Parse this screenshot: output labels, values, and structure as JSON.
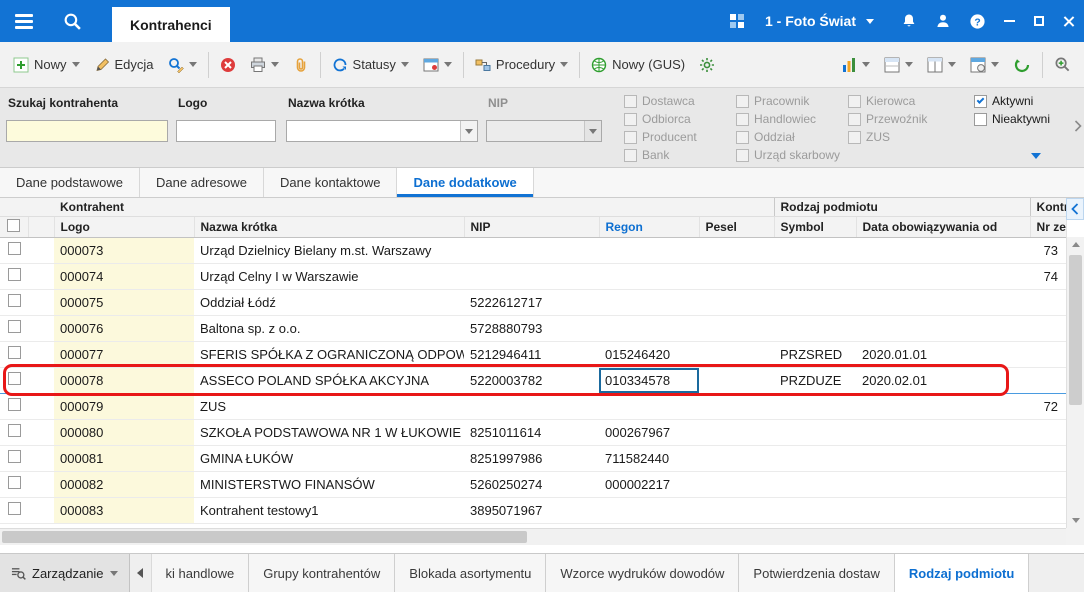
{
  "topbar": {
    "tab": "Kontrahenci",
    "company": "1 - Foto Świat"
  },
  "toolbar": {
    "nowy": "Nowy",
    "edycja": "Edycja",
    "statusy": "Statusy",
    "procedury": "Procedury",
    "nowy_gus": "Nowy (GUS)"
  },
  "filters": {
    "szukaj_label": "Szukaj kontrahenta",
    "szukaj_value": "",
    "logo_label": "Logo",
    "logo_value": "",
    "nazwa_label": "Nazwa krótka",
    "nazwa_value": "",
    "nip_label": "NIP",
    "nip_value": "",
    "roles_col1": [
      {
        "label": "Dostawca"
      },
      {
        "label": "Odbiorca"
      },
      {
        "label": "Producent"
      },
      {
        "label": "Bank"
      }
    ],
    "roles_col2": [
      {
        "label": "Pracownik"
      },
      {
        "label": "Handlowiec"
      },
      {
        "label": "Oddział"
      },
      {
        "label": "Urząd skarbowy"
      }
    ],
    "roles_col3": [
      {
        "label": "Kierowca"
      },
      {
        "label": "Przewoźnik"
      },
      {
        "label": "ZUS"
      }
    ],
    "aktywni": "Aktywni",
    "aktywni_checked": true,
    "nieaktywni": "Nieaktywni",
    "nieaktywni_checked": false
  },
  "tabs": {
    "items": [
      {
        "label": "Dane podstawowe",
        "active": false
      },
      {
        "label": "Dane adresowe",
        "active": false
      },
      {
        "label": "Dane kontaktowe",
        "active": false
      },
      {
        "label": "Dane dodatkowe",
        "active": true
      }
    ]
  },
  "table": {
    "group_kontrahent": "Kontrahent",
    "group_rodzaj_podmiotu": "Rodzaj podmiotu",
    "group_kontrah_cut": "Kontrah",
    "col_logo": "Logo",
    "col_nazwa": "Nazwa krótka",
    "col_nip": "NIP",
    "col_regon": "Regon",
    "col_pesel": "Pesel",
    "col_symbol": "Symbol",
    "col_data_od": "Data obowiązywania od",
    "col_nr_cut": "Nr zew",
    "rows": [
      {
        "logo": "000073",
        "nazwa": "Urząd Dzielnicy Bielany m.st. Warszawy",
        "nip": "",
        "regon": "",
        "pesel": "",
        "symbol": "",
        "data_od": "",
        "nr": "73"
      },
      {
        "logo": "000074",
        "nazwa": "Urząd Celny I w Warszawie",
        "nip": "",
        "regon": "",
        "pesel": "",
        "symbol": "",
        "data_od": "",
        "nr": "74"
      },
      {
        "logo": "000075",
        "nazwa": "Oddział Łódź",
        "nip": "5222612717",
        "regon": "",
        "pesel": "",
        "symbol": "",
        "data_od": "",
        "nr": ""
      },
      {
        "logo": "000076",
        "nazwa": "Baltona sp. z o.o.",
        "nip": "5728880793",
        "regon": "",
        "pesel": "",
        "symbol": "",
        "data_od": "",
        "nr": ""
      },
      {
        "logo": "000077",
        "nazwa": "SFERIS SPÓŁKA Z OGRANICZONĄ ODPOW",
        "nip": "5212946411",
        "regon": "015246420",
        "pesel": "",
        "symbol": "PRZSRED",
        "data_od": "2020.01.01",
        "nr": ""
      },
      {
        "logo": "000078",
        "nazwa": "ASSECO POLAND SPÓŁKA AKCYJNA",
        "nip": "5220003782",
        "regon": "010334578",
        "pesel": "",
        "symbol": "PRZDUZE",
        "data_od": "2020.02.01",
        "nr": "",
        "selected": true
      },
      {
        "logo": "000079",
        "nazwa": "ZUS",
        "nip": "",
        "regon": "",
        "pesel": "",
        "symbol": "",
        "data_od": "",
        "nr": "72"
      },
      {
        "logo": "000080",
        "nazwa": "SZKOŁA PODSTAWOWA NR 1 W ŁUKOWIE",
        "nip": "8251011614",
        "regon": "000267967",
        "pesel": "",
        "symbol": "",
        "data_od": "",
        "nr": ""
      },
      {
        "logo": "000081",
        "nazwa": "GMINA ŁUKÓW",
        "nip": "8251997986",
        "regon": "711582440",
        "pesel": "",
        "symbol": "",
        "data_od": "",
        "nr": ""
      },
      {
        "logo": "000082",
        "nazwa": "MINISTERSTWO FINANSÓW",
        "nip": "5260250274",
        "regon": "000002217",
        "pesel": "",
        "symbol": "",
        "data_od": "",
        "nr": ""
      },
      {
        "logo": "000083",
        "nazwa": "Kontrahent testowy1",
        "nip": "3895071967",
        "regon": "",
        "pesel": "",
        "symbol": "",
        "data_od": "",
        "nr": ""
      }
    ]
  },
  "bottombar": {
    "zarzadzanie": "Zarządzanie",
    "tabs": [
      {
        "label": "ki handlowe",
        "active": false
      },
      {
        "label": "Grupy kontrahentów",
        "active": false
      },
      {
        "label": "Blokada asortymentu",
        "active": false
      },
      {
        "label": "Wzorce wydruków dowodów",
        "active": false
      },
      {
        "label": "Potwierdzenia dostaw",
        "active": false
      },
      {
        "label": "Rodzaj podmiotu",
        "active": true
      }
    ]
  },
  "colors": {
    "topbar_blue": "#1273d4",
    "accent_blue": "#0d6fd1",
    "annotation_red": "#e81717",
    "logo_cell_yellow": "#fcf9dc",
    "selected_cell_border": "#1a6a9e"
  },
  "icons": [
    "hamburger-icon",
    "search-icon",
    "apps-grid-icon",
    "chevron-down-icon",
    "bell-icon",
    "user-icon",
    "help-icon",
    "minimize-icon",
    "maximize-icon",
    "close-icon",
    "new-plus-icon",
    "edit-pencil-icon",
    "find-edit-icon",
    "delete-icon",
    "print-icon",
    "attachment-icon",
    "statuses-icon",
    "views-icon",
    "procedures-icon",
    "gus-globe-icon",
    "settings-gear-icon",
    "chart-icon",
    "layout-icon",
    "group-layout-icon",
    "table-settings-icon",
    "refresh-icon",
    "advanced-search-icon",
    "checkbox-icon",
    "combo-arrow-icon",
    "collapse-left-icon",
    "scroll-arrow-icon",
    "manage-search-icon",
    "nav-left-icon"
  ]
}
